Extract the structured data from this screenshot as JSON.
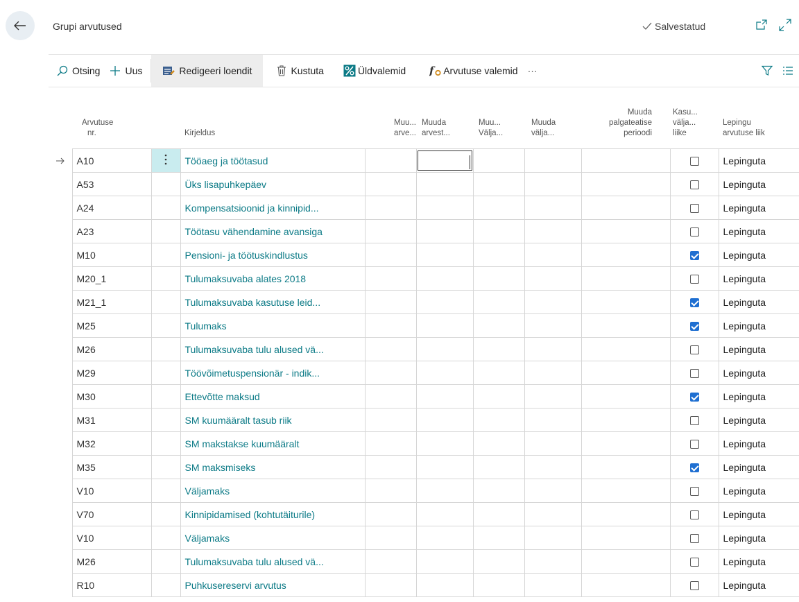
{
  "header": {
    "title": "Grupi arvutused",
    "saved_label": "Salvestatud"
  },
  "toolbar": {
    "search_label": "Otsing",
    "new_label": "Uus",
    "edit_list_label": "Redigeeri loendit",
    "delete_label": "Kustuta",
    "general_formulas_label": "Üldvalemid",
    "calc_formulas_label": "Arvutuse valemid",
    "more_label": "···"
  },
  "columns": {
    "calc_no": [
      "Arvutuse",
      "nr."
    ],
    "description": [
      "Kirjeldus"
    ],
    "col3": [
      "Muu...",
      "arve..."
    ],
    "col4": [
      "Muuda",
      "arvest..."
    ],
    "col5": [
      "Muu...",
      "Välja..."
    ],
    "col6": [
      "Muuda",
      "välja..."
    ],
    "col7": [
      "Muuda",
      "palgateatise",
      "perioodi"
    ],
    "col8": [
      "Kasu...",
      "välja...",
      "liike"
    ],
    "col9": [
      "Lepingu",
      "arvutuse liik"
    ]
  },
  "rows": [
    {
      "code": "A10",
      "description": "Tööaeg ja töötasud",
      "checked": false,
      "contract": "Lepinguta"
    },
    {
      "code": "A53",
      "description": "Üks lisapuhkepäev",
      "checked": false,
      "contract": "Lepinguta"
    },
    {
      "code": "A24",
      "description": "Kompensatsioonid ja kinnipid...",
      "checked": false,
      "contract": "Lepinguta"
    },
    {
      "code": "A23",
      "description": "Töötasu vähendamine avansiga",
      "checked": false,
      "contract": "Lepinguta"
    },
    {
      "code": "M10",
      "description": "Pensioni- ja töötuskindlustus",
      "checked": true,
      "contract": "Lepinguta"
    },
    {
      "code": "M20_1",
      "description": "Tulumaksuvaba alates 2018",
      "checked": false,
      "contract": "Lepinguta"
    },
    {
      "code": "M21_1",
      "description": "Tulumaksuvaba kasutuse leid...",
      "checked": true,
      "contract": "Lepinguta"
    },
    {
      "code": "M25",
      "description": "Tulumaks",
      "checked": true,
      "contract": "Lepinguta"
    },
    {
      "code": "M26",
      "description": "Tulumaksuvaba tulu alused vä...",
      "checked": false,
      "contract": "Lepinguta"
    },
    {
      "code": "M29",
      "description": "Töövõimetuspensionär - indik...",
      "checked": false,
      "contract": "Lepinguta"
    },
    {
      "code": "M30",
      "description": "Ettevõtte maksud",
      "checked": true,
      "contract": "Lepinguta"
    },
    {
      "code": "M31",
      "description": "SM kuumääralt tasub riik",
      "checked": false,
      "contract": "Lepinguta"
    },
    {
      "code": "M32",
      "description": "SM makstakse kuumääralt",
      "checked": false,
      "contract": "Lepinguta"
    },
    {
      "code": "M35",
      "description": "SM maksmiseks",
      "checked": true,
      "contract": "Lepinguta"
    },
    {
      "code": "V10",
      "description": "Väljamaks",
      "checked": false,
      "contract": "Lepinguta"
    },
    {
      "code": "V70",
      "description": "Kinnipidamised (kohtutäiturile)",
      "checked": false,
      "contract": "Lepinguta"
    },
    {
      "code": "V10",
      "description": "Väljamaks",
      "checked": false,
      "contract": "Lepinguta"
    },
    {
      "code": "M26",
      "description": "Tulumaksuvaba tulu alused vä...",
      "checked": false,
      "contract": "Lepinguta"
    },
    {
      "code": "R10",
      "description": "Puhkusereservi arvutus",
      "checked": false,
      "contract": "Lepinguta"
    }
  ],
  "colors": {
    "link": "#0b7a86",
    "checkbox_on": "#1f6fd1",
    "selected_cell": "#c9ecef"
  }
}
